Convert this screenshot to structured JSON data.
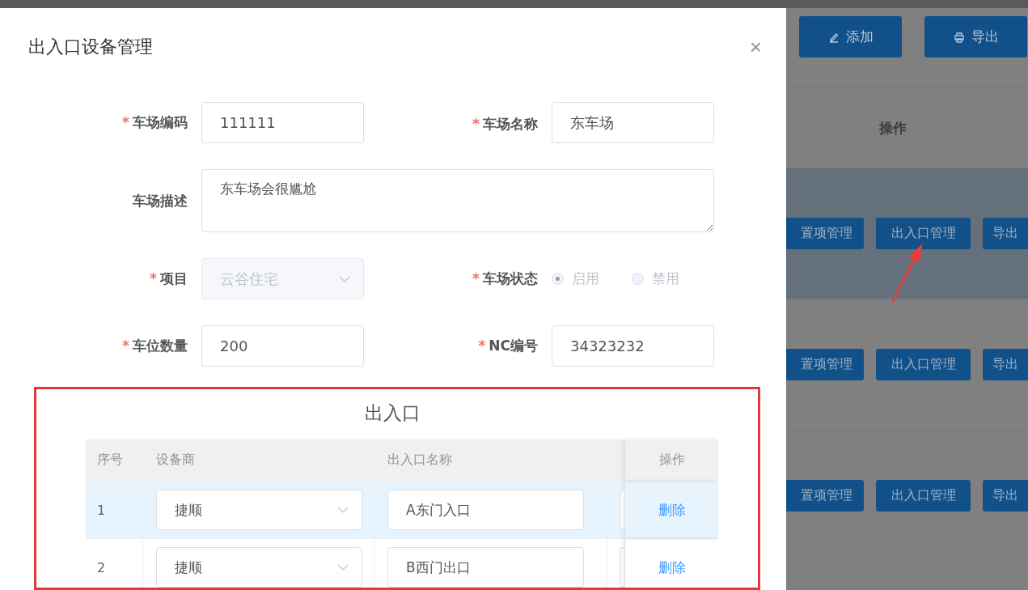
{
  "background": {
    "toolbar": [
      {
        "label": "添加"
      },
      {
        "label": "导出"
      }
    ],
    "table": {
      "header": "操作",
      "rows": [
        {
          "selected": true,
          "actions": [
            "置项管理",
            "出入口管理",
            "导出"
          ]
        },
        {
          "selected": false,
          "actions": [
            "置项管理",
            "出入口管理",
            "导出"
          ]
        },
        {
          "selected": false,
          "actions": [
            "置项管理",
            "出入口管理",
            "导出"
          ]
        }
      ]
    }
  },
  "dialog": {
    "title": "出入口设备管理",
    "close": "×",
    "fields": [
      {
        "kind": "input",
        "label": "车场编码",
        "required_mark": "*",
        "value": "111111"
      },
      {
        "kind": "input",
        "label": "车场名称",
        "required_mark": "*",
        "value": "东车场"
      },
      {
        "kind": "textarea",
        "label": "车场描述",
        "value": "东车场会很尴尬"
      },
      {
        "kind": "select",
        "label": "项目",
        "required_mark": "*",
        "value": "云谷住宅",
        "disabled": true
      },
      {
        "kind": "radio",
        "label": "车场状态",
        "required_mark": "*",
        "disabled": true,
        "options": [
          {
            "label": "启用",
            "selected": true
          },
          {
            "label": "禁用",
            "selected": false
          }
        ]
      },
      {
        "kind": "input",
        "label": "车位数量",
        "required_mark": "*",
        "value": "200"
      },
      {
        "kind": "input",
        "label": "NC编号",
        "required_mark": "*",
        "value": "34323232"
      }
    ],
    "section": {
      "title": "出入口",
      "columns": [
        "序号",
        "设备商",
        "出入口名称",
        "操作"
      ],
      "rows": [
        {
          "index": "1",
          "vendor": "捷顺",
          "name": "A东门入口",
          "action": "删除",
          "selected": true
        },
        {
          "index": "2",
          "vendor": "捷顺",
          "name": "B西门出口",
          "action": "删除",
          "selected": false
        }
      ]
    }
  }
}
